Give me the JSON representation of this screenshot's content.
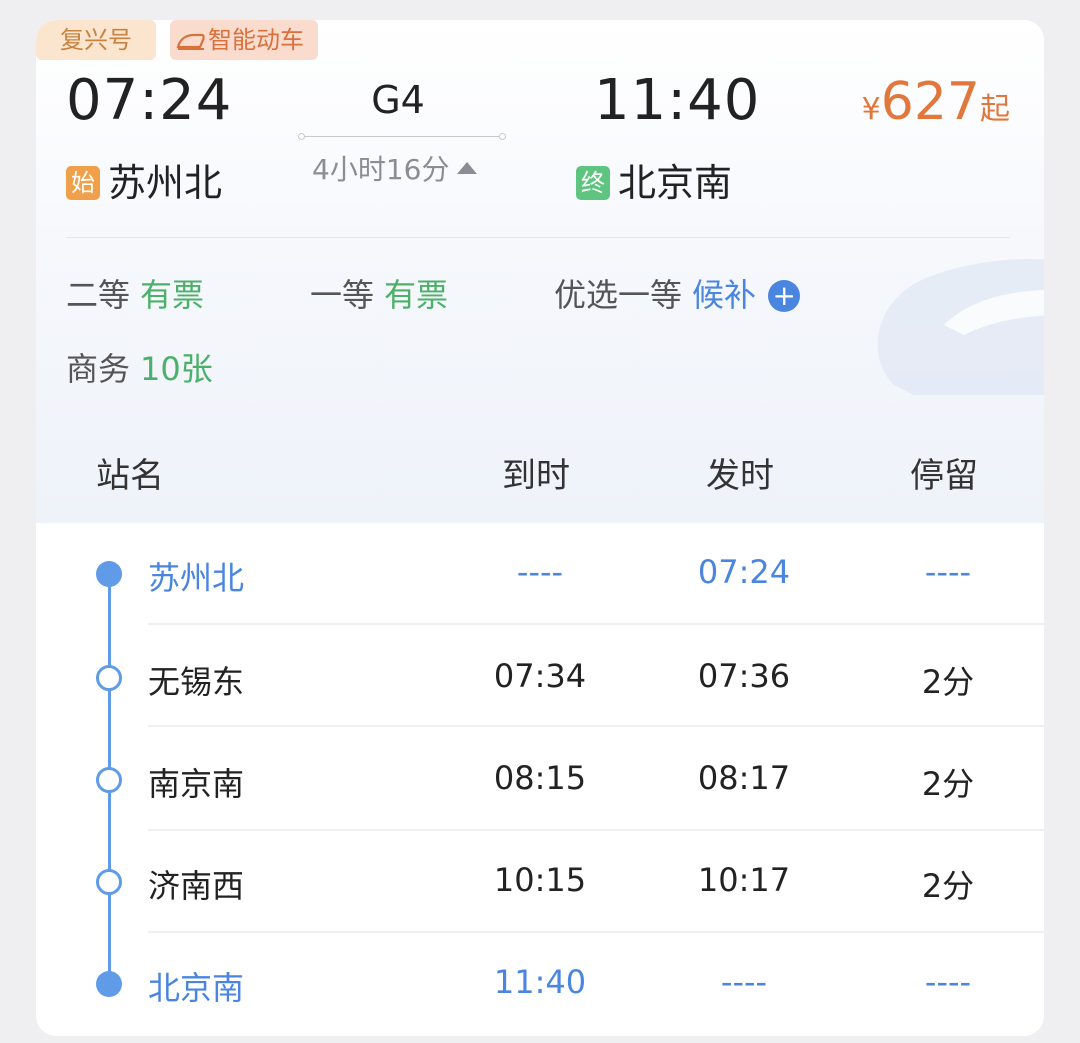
{
  "tags": {
    "train_class": "复兴号",
    "smart": "智能动车"
  },
  "trip": {
    "depart_time": "07:24",
    "arrive_time": "11:40",
    "train_no": "G4",
    "duration": "4小时16分",
    "depart_badge": "始",
    "depart_station": "苏州北",
    "arrive_badge": "终",
    "arrive_station": "北京南",
    "price_symbol": "¥",
    "price": "627",
    "price_suffix": "起"
  },
  "seats": [
    {
      "name": "二等",
      "status": "有票"
    },
    {
      "name": "一等",
      "status": "有票"
    },
    {
      "name": "优选一等",
      "status": "候补"
    },
    {
      "name": "商务",
      "status": "10张"
    }
  ],
  "table": {
    "headers": {
      "name": "站名",
      "arrive": "到时",
      "depart": "发时",
      "stay": "停留"
    },
    "rows": [
      {
        "name": "苏州北",
        "arrive": "----",
        "depart": "07:24",
        "stay": "----"
      },
      {
        "name": "无锡东",
        "arrive": "07:34",
        "depart": "07:36",
        "stay": "2分"
      },
      {
        "name": "南京南",
        "arrive": "08:15",
        "depart": "08:17",
        "stay": "2分"
      },
      {
        "name": "济南西",
        "arrive": "10:15",
        "depart": "10:17",
        "stay": "2分"
      },
      {
        "name": "北京南",
        "arrive": "11:40",
        "depart": "----",
        "stay": "----"
      }
    ]
  },
  "colors": {
    "accent_blue": "#4a86e0",
    "available_green": "#4cb06a",
    "price_orange": "#e2773c"
  }
}
